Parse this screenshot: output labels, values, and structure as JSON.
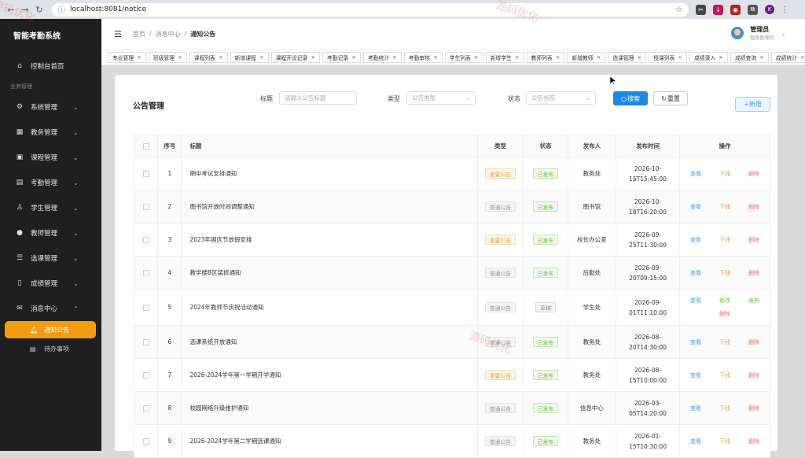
{
  "browser": {
    "url": "localhost:8081/notice",
    "profile_letter": "K"
  },
  "sidebar": {
    "brand": "智能考勤系统",
    "home": "控制台首页",
    "section": "业务管理",
    "items": [
      {
        "label": "系统管理",
        "icon": "gear-icon"
      },
      {
        "label": "教务管理",
        "icon": "building-icon"
      },
      {
        "label": "课程管理",
        "icon": "book-icon"
      },
      {
        "label": "考勤管理",
        "icon": "calendar-icon"
      },
      {
        "label": "学生管理",
        "icon": "person-icon"
      },
      {
        "label": "教师管理",
        "icon": "teacher-icon"
      },
      {
        "label": "选课管理",
        "icon": "list-icon"
      },
      {
        "label": "成绩管理",
        "icon": "document-icon"
      },
      {
        "label": "消息中心",
        "icon": "mail-icon"
      }
    ],
    "sub_active": "通知公告",
    "sub_item": "待办事项"
  },
  "header": {
    "breadcrumb": [
      "首页",
      "消息中心",
      "通知公告"
    ],
    "user_name": "管理员",
    "user_role": "超级管理员"
  },
  "tags": [
    "专业管理",
    "班级管理",
    "课程列表",
    "新增课程",
    "课程开设记录",
    "考勤记录",
    "考勤统计",
    "考勤审核",
    "学生列表",
    "新增学生",
    "教师列表",
    "新增教师",
    "选课管理",
    "授课列表",
    "成绩录入",
    "成绩查询",
    "成绩统计"
  ],
  "card": {
    "title": "公告管理",
    "filters": {
      "title_label": "标题",
      "title_placeholder": "请输入公告标题",
      "type_label": "类型",
      "type_placeholder": "公告类型",
      "status_label": "状态",
      "status_placeholder": "公告状态"
    },
    "search_btn": "搜索",
    "reset_btn": "重置",
    "add_btn": "新增"
  },
  "table": {
    "headers": [
      "序号",
      "标题",
      "类型",
      "状态",
      "发布人",
      "发布时间",
      "操作"
    ],
    "rows": [
      {
        "no": "1",
        "title": "期中考试安排通知",
        "type": "重要公告",
        "status": "已发布",
        "publisher": "教务处",
        "time_a": "2026-10-",
        "time_b": "15T15:45:00",
        "ops": [
          "查看",
          "下线",
          "删除"
        ]
      },
      {
        "no": "2",
        "title": "图书馆开放时间调整通知",
        "type": "普通公告",
        "status": "已发布",
        "publisher": "图书馆",
        "time_a": "2026-10-",
        "time_b": "10T16:20:00",
        "ops": [
          "查看",
          "下线",
          "删除"
        ]
      },
      {
        "no": "3",
        "title": "2023年国庆节放假安排",
        "type": "重要公告",
        "status": "已发布",
        "publisher": "校长办公室",
        "time_a": "2026-09-",
        "time_b": "25T11:30:00",
        "ops": [
          "查看",
          "下线",
          "删除"
        ]
      },
      {
        "no": "4",
        "title": "教学楼B区装修通知",
        "type": "普通公告",
        "status": "已发布",
        "publisher": "后勤处",
        "time_a": "2026-09-",
        "time_b": "20T09:15:00",
        "ops": [
          "查看",
          "下线",
          "删除"
        ]
      },
      {
        "no": "5",
        "title": "2024年教师节庆祝活动通知",
        "type": "普通公告",
        "status": "草稿",
        "publisher": "学生处",
        "time_a": "2026-09-",
        "time_b": "01T11:10:00",
        "ops": [
          "查看",
          "修改",
          "发布",
          "删除"
        ]
      },
      {
        "no": "6",
        "title": "选课系统开放通知",
        "type": "普通公告",
        "status": "已发布",
        "publisher": "教务处",
        "time_a": "2026-08-",
        "time_b": "20T14:30:00",
        "ops": [
          "查看",
          "下线",
          "删除"
        ]
      },
      {
        "no": "7",
        "title": "2026-2024学年第一学期开学通知",
        "type": "重要公告",
        "status": "已发布",
        "publisher": "教务处",
        "time_a": "2026-08-",
        "time_b": "15T10:00:00",
        "ops": [
          "查看",
          "下线",
          "删除"
        ]
      },
      {
        "no": "8",
        "title": "校园网络升级维护通知",
        "type": "普通公告",
        "status": "已发布",
        "publisher": "信息中心",
        "time_a": "2026-03-",
        "time_b": "05T14:20:00",
        "ops": [
          "查看",
          "下线",
          "删除"
        ]
      },
      {
        "no": "9",
        "title": "2026-2024学年第二学期选课通知",
        "type": "普通公告",
        "status": "已发布",
        "publisher": "教务处",
        "time_a": "2026-01-",
        "time_b": "15T10:30:00",
        "ops": [
          "查看",
          "下线",
          "删除"
        ]
      }
    ]
  },
  "watermark": "源码优化"
}
